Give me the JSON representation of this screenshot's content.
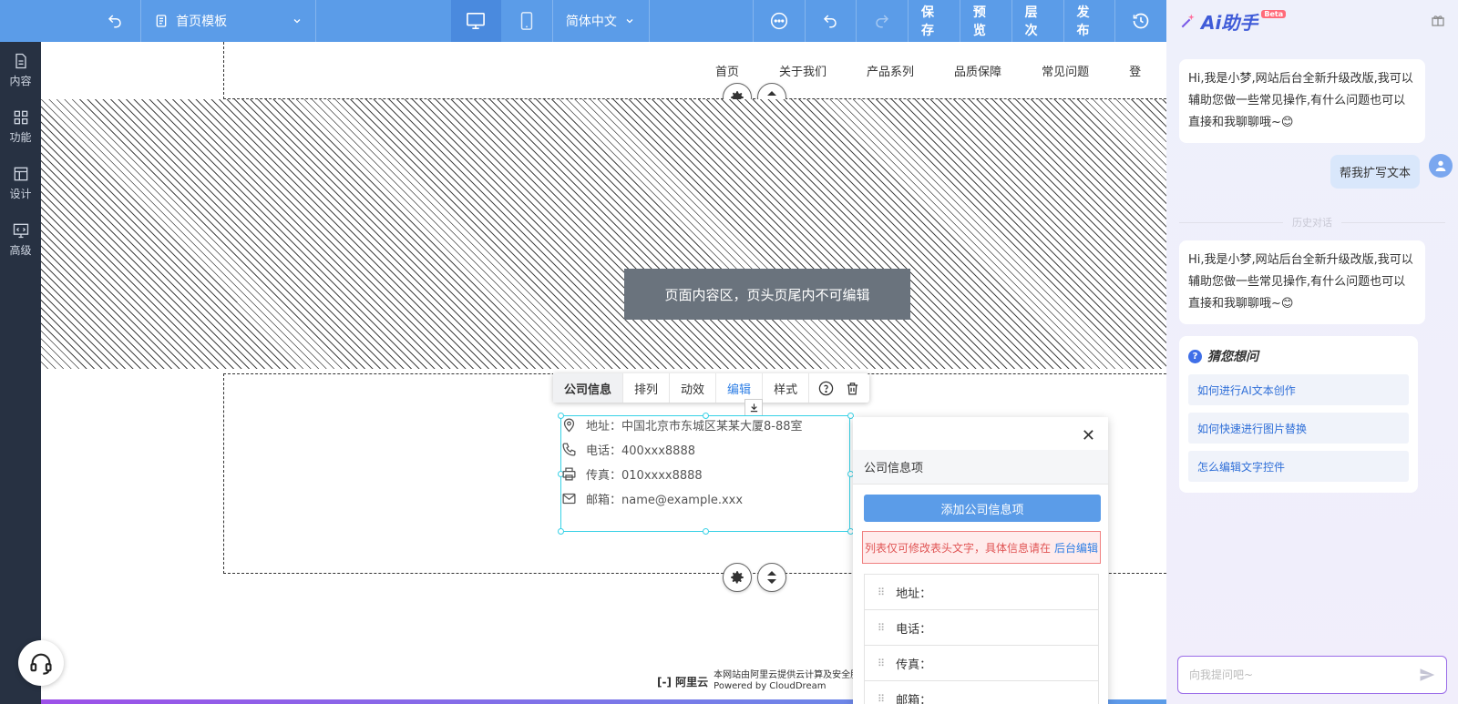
{
  "toolbar": {
    "template_label": "首页模板",
    "language_label": "简体中文",
    "save_label": "保存",
    "preview_label": "预览",
    "layers_label": "层次",
    "publish_label": "发布"
  },
  "sidebar": {
    "items": [
      {
        "label": "内容"
      },
      {
        "label": "功能"
      },
      {
        "label": "设计"
      },
      {
        "label": "高级"
      }
    ]
  },
  "canvas": {
    "nav": [
      "首页",
      "关于我们",
      "产品系列",
      "品质保障",
      "常见问题",
      "登"
    ],
    "content_area_label": "页面内容区，页头页尾内不可编辑",
    "context_toolbar": {
      "company_info": "公司信息",
      "arrange": "排列",
      "animation": "动效",
      "edit": "编辑",
      "style": "样式"
    },
    "company_info": [
      {
        "label": "地址：",
        "value": "中国北京市东城区某某大厦8-88室"
      },
      {
        "label": "电话：",
        "value": "400xxx8888"
      },
      {
        "label": "传真：",
        "value": "010xxxx8888"
      },
      {
        "label": "邮箱：",
        "value": "name@example.xxx"
      }
    ],
    "powered_logo": "阿里云",
    "powered_line1": "本网站由阿里云提供云计算及安全服务",
    "powered_line2": "Powered by CloudDream"
  },
  "panel": {
    "title": "公司信息项",
    "add_button": "添加公司信息项",
    "warning_text": "列表仅可修改表头文字，具体信息请在",
    "warning_link": "后台编辑",
    "items": [
      "地址：",
      "电话：",
      "传真：",
      "邮箱："
    ]
  },
  "ai": {
    "logo_text": "Ai助手",
    "beta": "Beta",
    "greeting": "Hi,我是小梦,网站后台全新升级改版,我可以辅助您做一些常见操作,有什么问题也可以直接和我聊聊哦~😊",
    "user_message": "帮我扩写文本",
    "history_label": "历史对话",
    "greeting2": "Hi,我是小梦,网站后台全新升级改版,我可以辅助您做一些常见操作,有什么问题也可以直接和我聊聊哦~😊",
    "guess_title": "猜您想问",
    "suggestions": [
      "如何进行AI文本创作",
      "如何快速进行图片替换",
      "怎么编辑文字控件"
    ],
    "input_placeholder": "向我提问吧~"
  }
}
